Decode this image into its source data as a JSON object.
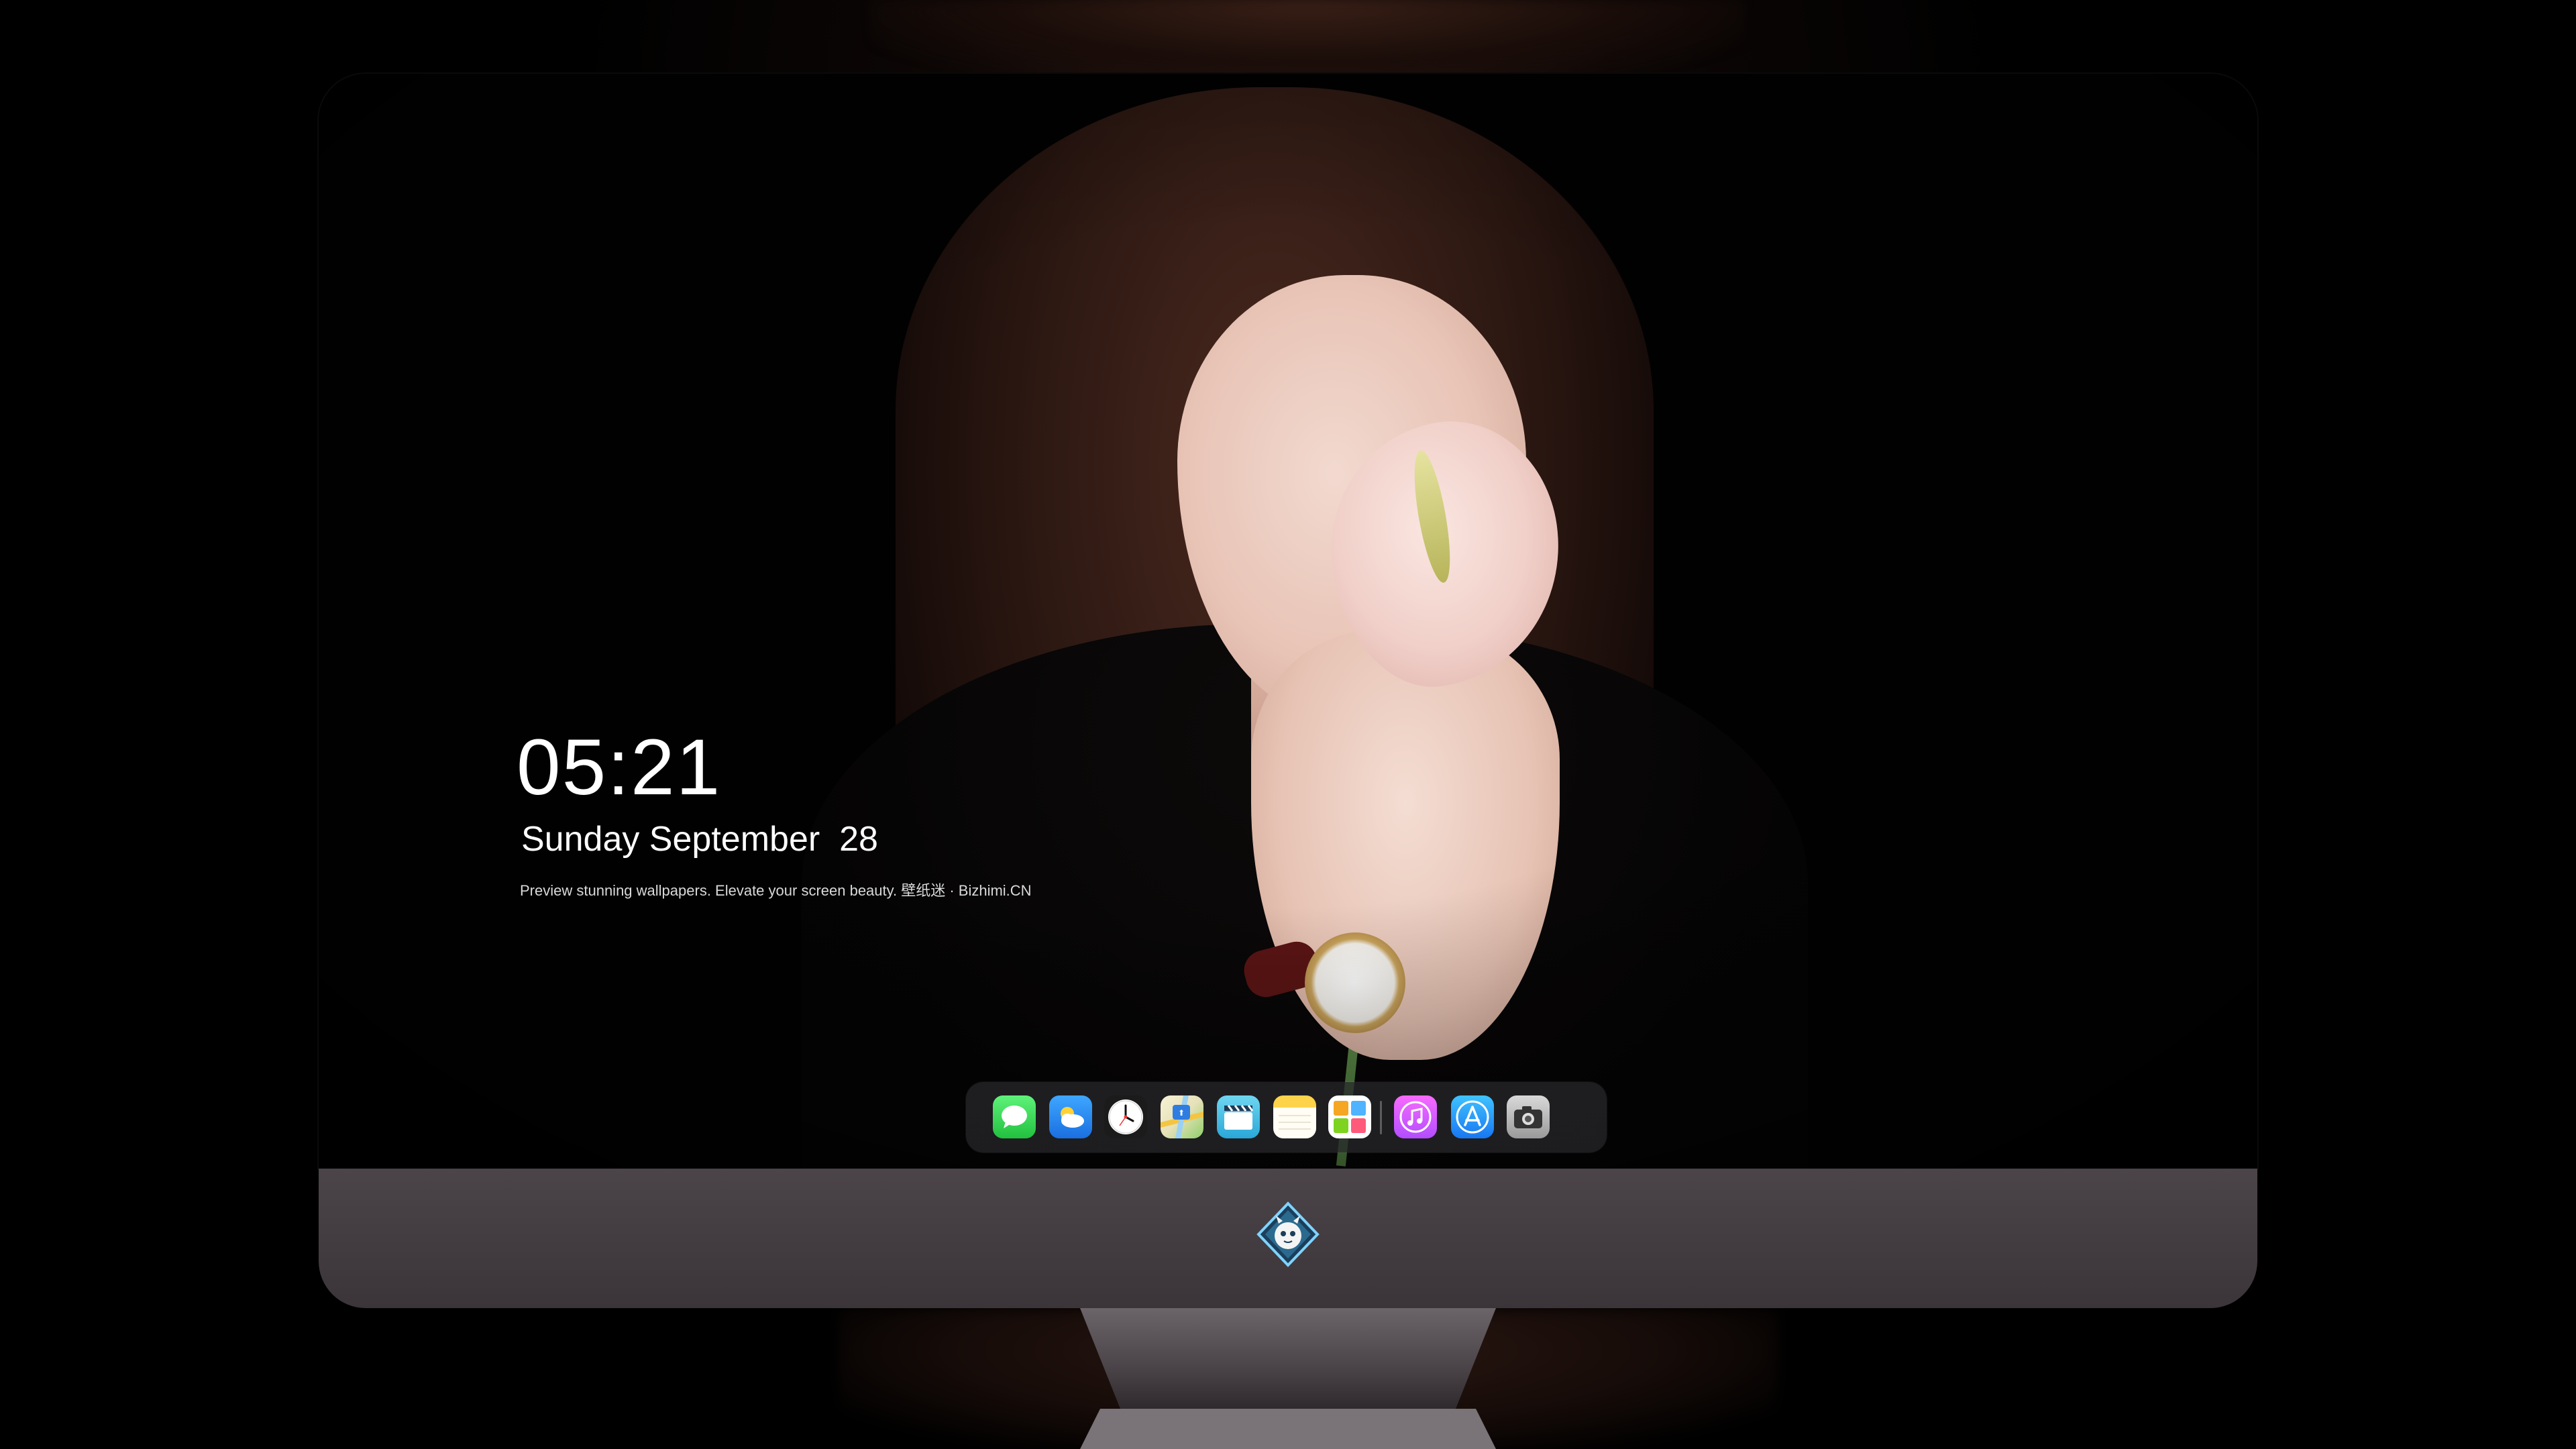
{
  "lock_screen": {
    "time": "05:21",
    "date": "Sunday September  28",
    "tagline": "Preview stunning wallpapers. Elevate your screen beauty. 壁纸迷 · Bizhimi.CN"
  },
  "dock": {
    "apps": [
      {
        "name": "messages",
        "icon": "messages-icon"
      },
      {
        "name": "weather",
        "icon": "weather-icon"
      },
      {
        "name": "clock",
        "icon": "clock-icon"
      },
      {
        "name": "maps",
        "icon": "maps-icon"
      },
      {
        "name": "clips",
        "icon": "clapperboard-icon"
      },
      {
        "name": "notes",
        "icon": "notes-icon"
      },
      {
        "name": "photos",
        "icon": "photos-icon"
      },
      {
        "name": "music",
        "icon": "music-note-icon"
      },
      {
        "name": "app-store",
        "icon": "app-store-icon"
      },
      {
        "name": "camera",
        "icon": "camera-icon"
      }
    ]
  },
  "colors": {
    "background": "#000000",
    "chin": "#433c41",
    "dock": "#28282c",
    "text": "#ffffff"
  },
  "brand": {
    "logo_icon": "dragon-mascot-logo-icon"
  }
}
